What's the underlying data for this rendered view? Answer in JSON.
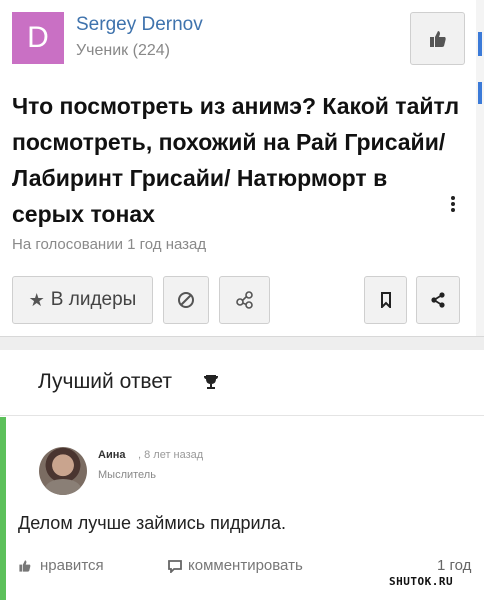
{
  "question": {
    "author": {
      "avatar_letter": "D",
      "name": "Sergey Dernov",
      "rank": "Ученик (224)"
    },
    "title": "Что посмотреть из анимэ? Какой тайтл посмотреть, похожий на Рай Грисайи/Лабиринт Грисайи/ Натюрморт в серых тонах",
    "meta": "На голосовании 1 год назад",
    "buttons": {
      "leaders_label": "В лидеры",
      "leaders_icon": "star-icon",
      "ban_icon": "ban-icon",
      "share_icon": "share-nodes-icon",
      "bookmark_icon": "bookmark-icon",
      "share2_icon": "share-icon",
      "like_icon": "thumbs-up-icon"
    }
  },
  "best_answer": {
    "header": "Лучший ответ",
    "header_icon": "trophy-icon",
    "author": {
      "name": "Аина",
      "time": ", 8 лет назад",
      "rank": "Мыслитель"
    },
    "text": "Делом лучше займись пидрила.",
    "actions": {
      "like_label": "нравится",
      "comment_label": "комментировать",
      "time": "1 год"
    }
  },
  "watermark": "SHUTOK.RU",
  "colors": {
    "accent_link": "#3f73ad",
    "avatar_bg": "#c970c4",
    "best_answer_border": "#5cc05a"
  }
}
